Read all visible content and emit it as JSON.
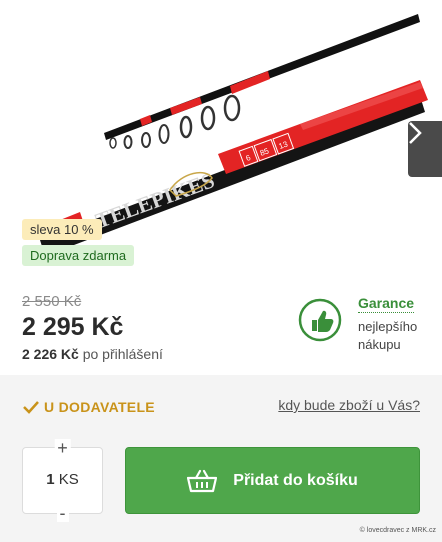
{
  "badges": {
    "sale": "sleva 10 %",
    "shipping": "Doprava zdarma"
  },
  "pricing": {
    "old_price": "2 550 Kč",
    "price": "2 295 Kč",
    "login_price_value": "2 226 Kč",
    "login_price_label": "po přihlášení"
  },
  "guarantee": {
    "title": "Garance",
    "subtitle": "nejlepšího nákupu"
  },
  "availability": {
    "status": "U DODAVATELE",
    "delivery_link": "kdy bude zboží u Vás?"
  },
  "quantity": {
    "plus": "+",
    "minus": "-",
    "value": "1",
    "unit": "KS"
  },
  "cart": {
    "add_label": "Přidat do košíku"
  },
  "product_image": {
    "rod_brand": "TELEPIKES",
    "rod_spec_1": "6",
    "rod_spec_2": "85",
    "rod_spec_3": "13"
  },
  "footer": {
    "copyright": "© lovecdravec z MRK.cz"
  },
  "colors": {
    "accent_green": "#4fa74b",
    "supplier_gold": "#c9931a",
    "rod_red": "#e32424"
  },
  "icons": {
    "next": "chevron-right-icon",
    "check": "check-icon",
    "guarantee": "thumbs-up-shield-icon",
    "basket": "basket-icon"
  }
}
